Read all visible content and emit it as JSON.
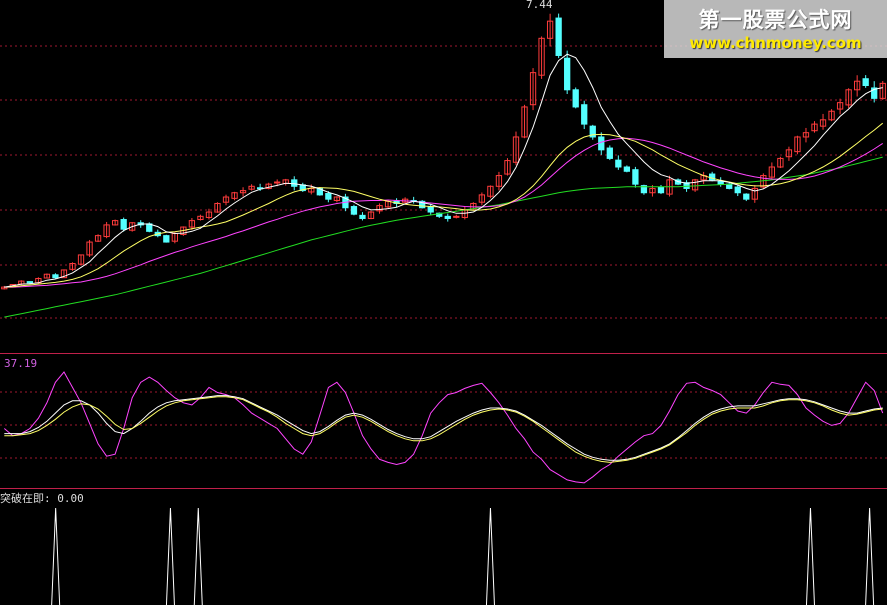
{
  "watermark": {
    "title": "第一股票公式网",
    "url": "www.chnmoney.com"
  },
  "labels": {
    "price_peak": "7.44",
    "oscillator_value": "37.19",
    "signal_label": "突破在即: 0.00"
  },
  "colors": {
    "background": "#000000",
    "up_candle": "#ff3c3c",
    "down_candle": "#54ffff",
    "ma_short": "#ffffff",
    "ma_mid": "#ffff66",
    "ma_long": "#ff44ff",
    "ma_very_long": "#22dd22",
    "grid": "#a01830",
    "separator": "#c0204a"
  },
  "chart_data": [
    {
      "type": "candlestick",
      "peak_label": "7.44",
      "closes": [
        1.0,
        1.06,
        1.14,
        1.1,
        1.2,
        1.3,
        1.22,
        1.4,
        1.55,
        1.75,
        2.05,
        2.2,
        2.45,
        2.55,
        2.35,
        2.5,
        2.45,
        2.3,
        2.2,
        2.05,
        2.25,
        2.4,
        2.55,
        2.65,
        2.75,
        2.95,
        3.1,
        3.2,
        3.25,
        3.35,
        3.3,
        3.4,
        3.45,
        3.5,
        3.35,
        3.25,
        3.3,
        3.15,
        3.05,
        3.1,
        2.85,
        2.7,
        2.6,
        2.75,
        2.9,
        3.0,
        2.95,
        3.05,
        3.0,
        2.85,
        2.75,
        2.65,
        2.6,
        2.65,
        2.8,
        2.95,
        3.15,
        3.35,
        3.6,
        3.95,
        4.5,
        5.2,
        6.0,
        6.8,
        7.2,
        6.4,
        5.6,
        5.2,
        4.8,
        4.5,
        4.2,
        4.0,
        3.8,
        3.7,
        3.4,
        3.2,
        3.3,
        3.2,
        3.5,
        3.4,
        3.3,
        3.5,
        3.6,
        3.5,
        3.4,
        3.3,
        3.2,
        3.05,
        3.3,
        3.6,
        3.8,
        4.0,
        4.2,
        4.5,
        4.6,
        4.8,
        4.9,
        5.1,
        5.3,
        5.6,
        5.8,
        5.7,
        5.4,
        5.75
      ],
      "ma_short": [
        1.0,
        1.03,
        1.07,
        1.08,
        1.1,
        1.16,
        1.19,
        1.25,
        1.33,
        1.46,
        1.59,
        1.79,
        1.97,
        2.16,
        2.32,
        2.41,
        2.47,
        2.47,
        2.41,
        2.29,
        2.25,
        2.26,
        2.3,
        2.37,
        2.52,
        2.66,
        2.82,
        2.96,
        3.09,
        3.21,
        3.28,
        3.33,
        3.37,
        3.42,
        3.41,
        3.38,
        3.35,
        3.29,
        3.21,
        3.15,
        3.07,
        2.98,
        2.87,
        2.8,
        2.81,
        2.83,
        2.86,
        2.94,
        3.0,
        2.97,
        2.93,
        2.86,
        2.78,
        2.72,
        2.72,
        2.75,
        2.86,
        3.02,
        3.21,
        3.46,
        3.79,
        4.23,
        4.73,
        5.32,
        5.94,
        6.28,
        6.43,
        6.35,
        6.05,
        5.65,
        5.19,
        4.86,
        4.56,
        4.34,
        4.13,
        3.92,
        3.74,
        3.62,
        3.56,
        3.46,
        3.42,
        3.44,
        3.48,
        3.48,
        3.48,
        3.44,
        3.38,
        3.3,
        3.24,
        3.29,
        3.4,
        3.55,
        3.71,
        3.9,
        4.1,
        4.3,
        4.54,
        4.76,
        4.98,
        5.15,
        5.35,
        5.51,
        5.61,
        5.65
      ],
      "ma_mid": [
        1.0,
        1.01,
        1.03,
        1.05,
        1.07,
        1.09,
        1.11,
        1.14,
        1.18,
        1.24,
        1.33,
        1.43,
        1.56,
        1.7,
        1.84,
        1.96,
        2.08,
        2.18,
        2.24,
        2.28,
        2.29,
        2.32,
        2.36,
        2.4,
        2.43,
        2.47,
        2.52,
        2.6,
        2.68,
        2.77,
        2.86,
        2.95,
        3.05,
        3.14,
        3.22,
        3.27,
        3.31,
        3.32,
        3.31,
        3.3,
        3.27,
        3.23,
        3.17,
        3.11,
        3.05,
        3.0,
        2.96,
        2.93,
        2.91,
        2.89,
        2.88,
        2.87,
        2.85,
        2.83,
        2.8,
        2.79,
        2.8,
        2.82,
        2.87,
        2.94,
        3.04,
        3.18,
        3.36,
        3.58,
        3.83,
        4.07,
        4.26,
        4.4,
        4.5,
        4.55,
        4.56,
        4.55,
        4.51,
        4.46,
        4.4,
        4.3,
        4.2,
        4.08,
        3.97,
        3.86,
        3.77,
        3.68,
        3.6,
        3.54,
        3.49,
        3.45,
        3.41,
        3.38,
        3.36,
        3.36,
        3.38,
        3.41,
        3.46,
        3.53,
        3.61,
        3.7,
        3.8,
        3.92,
        4.05,
        4.2,
        4.35,
        4.51,
        4.66,
        4.82
      ],
      "ma_long": [
        1.0,
        1.0,
        1.01,
        1.02,
        1.03,
        1.04,
        1.06,
        1.08,
        1.1,
        1.12,
        1.16,
        1.2,
        1.25,
        1.31,
        1.38,
        1.45,
        1.52,
        1.6,
        1.67,
        1.74,
        1.81,
        1.87,
        1.94,
        2.0,
        2.06,
        2.12,
        2.18,
        2.25,
        2.31,
        2.38,
        2.45,
        2.52,
        2.58,
        2.65,
        2.71,
        2.77,
        2.82,
        2.87,
        2.91,
        2.95,
        2.98,
        3.0,
        3.01,
        3.02,
        3.02,
        3.03,
        3.02,
        3.01,
        3.0,
        2.98,
        2.96,
        2.94,
        2.92,
        2.9,
        2.88,
        2.87,
        2.87,
        2.88,
        2.9,
        2.94,
        3.01,
        3.1,
        3.23,
        3.38,
        3.56,
        3.74,
        3.91,
        4.06,
        4.19,
        4.3,
        4.38,
        4.43,
        4.46,
        4.47,
        4.45,
        4.42,
        4.37,
        4.31,
        4.24,
        4.16,
        4.08,
        4.0,
        3.92,
        3.85,
        3.78,
        3.72,
        3.66,
        3.61,
        3.57,
        3.54,
        3.52,
        3.51,
        3.51,
        3.52,
        3.55,
        3.59,
        3.65,
        3.72,
        3.8,
        3.89,
        3.99,
        4.1,
        4.22,
        4.35
      ],
      "ma_very_long": [
        0.3,
        0.34,
        0.38,
        0.42,
        0.46,
        0.5,
        0.54,
        0.58,
        0.62,
        0.66,
        0.7,
        0.74,
        0.78,
        0.82,
        0.87,
        0.92,
        0.97,
        1.02,
        1.07,
        1.12,
        1.17,
        1.22,
        1.27,
        1.32,
        1.38,
        1.44,
        1.5,
        1.56,
        1.62,
        1.68,
        1.74,
        1.8,
        1.86,
        1.92,
        1.98,
        2.04,
        2.1,
        2.15,
        2.2,
        2.25,
        2.3,
        2.35,
        2.4,
        2.44,
        2.48,
        2.52,
        2.56,
        2.59,
        2.62,
        2.65,
        2.68,
        2.71,
        2.74,
        2.77,
        2.8,
        2.83,
        2.86,
        2.89,
        2.92,
        2.96,
        3.0,
        3.04,
        3.08,
        3.12,
        3.16,
        3.2,
        3.23,
        3.26,
        3.28,
        3.3,
        3.31,
        3.32,
        3.33,
        3.34,
        3.34,
        3.34,
        3.34,
        3.34,
        3.34,
        3.34,
        3.35,
        3.36,
        3.37,
        3.38,
        3.39,
        3.4,
        3.42,
        3.44,
        3.46,
        3.48,
        3.5,
        3.53,
        3.56,
        3.59,
        3.62,
        3.66,
        3.7,
        3.74,
        3.78,
        3.83,
        3.88,
        3.93,
        3.98,
        4.03
      ],
      "ylim": [
        0.0,
        7.6
      ]
    },
    {
      "type": "line",
      "value_label": "37.19",
      "series": [
        {
          "values": [
            55,
            48,
            50,
            55,
            65,
            80,
            100,
            110,
            95,
            80,
            60,
            40,
            28,
            30,
            55,
            85,
            100,
            105,
            100,
            92,
            85,
            80,
            78,
            85,
            95,
            90,
            88,
            85,
            78,
            70,
            65,
            60,
            55,
            45,
            35,
            30,
            42,
            68,
            95,
            100,
            90,
            70,
            48,
            35,
            25,
            22,
            20,
            22,
            30,
            48,
            70,
            80,
            88,
            90,
            94,
            97,
            99,
            90,
            80,
            68,
            55,
            45,
            32,
            25,
            15,
            10,
            5,
            3,
            2,
            8,
            15,
            20,
            28,
            35,
            42,
            48,
            50,
            58,
            72,
            88,
            99,
            100,
            95,
            92,
            88,
            80,
            72,
            70,
            78,
            90,
            100,
            98,
            97,
            88,
            75,
            68,
            62,
            58,
            60,
            70,
            85,
            100,
            92,
            70
          ]
        },
        {
          "values": [
            50,
            50,
            50,
            52,
            56,
            62,
            70,
            78,
            82,
            82,
            78,
            70,
            60,
            52,
            50,
            55,
            62,
            70,
            76,
            80,
            82,
            83,
            84,
            85,
            86,
            87,
            87,
            86,
            84,
            80,
            76,
            72,
            68,
            63,
            58,
            53,
            50,
            52,
            57,
            63,
            68,
            70,
            68,
            64,
            59,
            54,
            50,
            47,
            45,
            45,
            47,
            52,
            57,
            62,
            66,
            70,
            73,
            75,
            75,
            74,
            72,
            68,
            63,
            58,
            52,
            46,
            40,
            35,
            30,
            27,
            25,
            24,
            24,
            25,
            27,
            30,
            33,
            36,
            40,
            46,
            53,
            60,
            66,
            71,
            74,
            76,
            77,
            77,
            77,
            79,
            81,
            83,
            84,
            84,
            83,
            81,
            78,
            75,
            72,
            70,
            70,
            72,
            74,
            75
          ]
        },
        {
          "values": [
            48,
            48,
            49,
            50,
            53,
            58,
            64,
            71,
            76,
            79,
            78,
            74,
            67,
            59,
            54,
            55,
            60,
            66,
            72,
            77,
            80,
            82,
            83,
            84,
            85,
            86,
            86,
            85,
            83,
            79,
            75,
            71,
            66,
            60,
            55,
            50,
            48,
            50,
            55,
            61,
            66,
            68,
            66,
            62,
            57,
            52,
            48,
            45,
            43,
            43,
            45,
            49,
            54,
            59,
            64,
            68,
            71,
            73,
            74,
            73,
            71,
            67,
            62,
            56,
            50,
            44,
            38,
            32,
            28,
            25,
            23,
            22,
            23,
            24,
            26,
            29,
            32,
            35,
            39,
            45,
            51,
            58,
            64,
            69,
            72,
            74,
            75,
            75,
            75,
            77,
            80,
            82,
            83,
            83,
            82,
            80,
            77,
            73,
            70,
            68,
            69,
            71,
            73,
            74
          ]
        }
      ],
      "ylim": [
        0,
        110
      ]
    },
    {
      "type": "line",
      "series": [
        {
          "name": "突破在即",
          "spikes_at": [
            16,
            49,
            57,
            141,
            233,
            250
          ]
        }
      ],
      "ylim": [
        0,
        1
      ]
    }
  ]
}
